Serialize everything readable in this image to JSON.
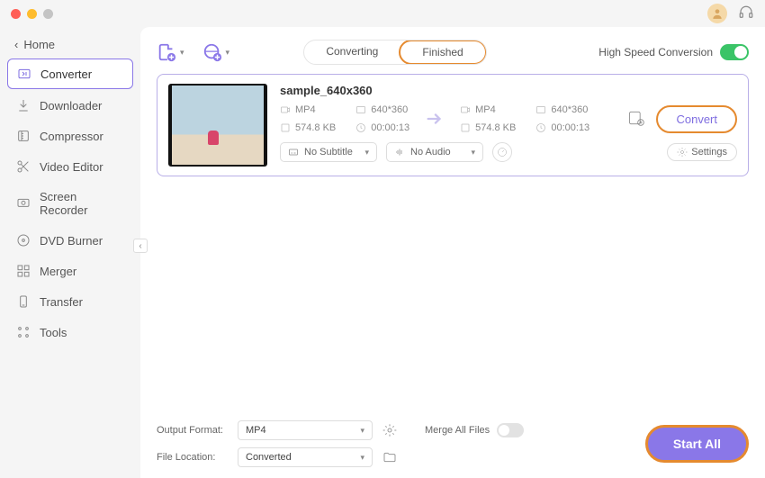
{
  "sidebar": {
    "home": "Home",
    "items": [
      {
        "label": "Converter"
      },
      {
        "label": "Downloader"
      },
      {
        "label": "Compressor"
      },
      {
        "label": "Video Editor"
      },
      {
        "label": "Screen Recorder"
      },
      {
        "label": "DVD Burner"
      },
      {
        "label": "Merger"
      },
      {
        "label": "Transfer"
      },
      {
        "label": "Tools"
      }
    ]
  },
  "tabs": {
    "converting": "Converting",
    "finished": "Finished"
  },
  "hsc_label": "High Speed Conversion",
  "file": {
    "name": "sample_640x360",
    "src": {
      "format": "MP4",
      "res": "640*360",
      "size": "574.8 KB",
      "dur": "00:00:13"
    },
    "dst": {
      "format": "MP4",
      "res": "640*360",
      "size": "574.8 KB",
      "dur": "00:00:13"
    },
    "subtitle": "No Subtitle",
    "audio": "No Audio",
    "settings_label": "Settings",
    "convert_label": "Convert"
  },
  "footer": {
    "output_format_label": "Output Format:",
    "output_format_value": "MP4",
    "file_location_label": "File Location:",
    "file_location_value": "Converted",
    "merge_label": "Merge All Files",
    "start_all": "Start All"
  }
}
